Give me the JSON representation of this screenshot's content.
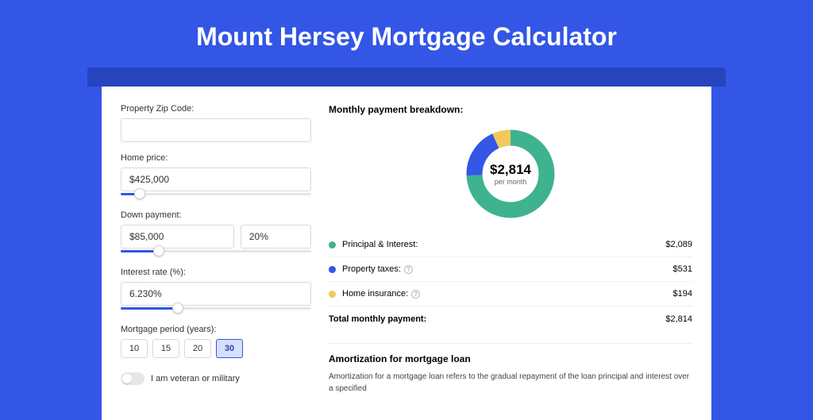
{
  "title": "Mount Hersey Mortgage Calculator",
  "inputs": {
    "zip_label": "Property Zip Code:",
    "zip_value": "",
    "home_price_label": "Home price:",
    "home_price_value": "$425,000",
    "home_price_slider_pct": 10,
    "down_label": "Down payment:",
    "down_value": "$85,000",
    "down_pct_value": "20%",
    "down_slider_pct": 20,
    "rate_label": "Interest rate (%):",
    "rate_value": "6.230%",
    "rate_slider_pct": 30,
    "period_label": "Mortgage period (years):",
    "period_options": [
      "10",
      "15",
      "20",
      "30"
    ],
    "period_selected": "30",
    "veteran_label": "I am veteran or military"
  },
  "breakdown": {
    "title": "Monthly payment breakdown:",
    "center_amount": "$2,814",
    "center_sub": "per month",
    "items": [
      {
        "label": "Principal & Interest:",
        "value": "$2,089",
        "color": "#3fb28f",
        "has_help": false
      },
      {
        "label": "Property taxes:",
        "value": "$531",
        "color": "#3356e6",
        "has_help": true
      },
      {
        "label": "Home insurance:",
        "value": "$194",
        "color": "#f3c95b",
        "has_help": true
      }
    ],
    "total_label": "Total monthly payment:",
    "total_value": "$2,814"
  },
  "amortization": {
    "title": "Amortization for mortgage loan",
    "text": "Amortization for a mortgage loan refers to the gradual repayment of the loan principal and interest over a specified"
  },
  "chart_data": {
    "type": "pie",
    "title": "Monthly payment breakdown",
    "series": [
      {
        "name": "Principal & Interest",
        "value": 2089,
        "color": "#3fb28f"
      },
      {
        "name": "Property taxes",
        "value": 531,
        "color": "#3356e6"
      },
      {
        "name": "Home insurance",
        "value": 194,
        "color": "#f3c95b"
      }
    ],
    "total": 2814,
    "center_label": "$2,814 per month"
  }
}
